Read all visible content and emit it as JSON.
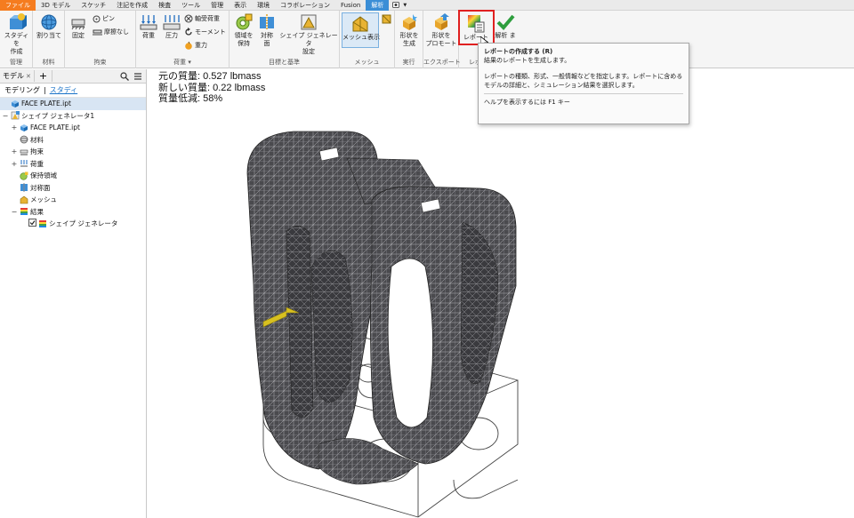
{
  "menu": {
    "items": [
      "ファイル",
      "3D モデル",
      "スケッチ",
      "注記を作成",
      "検査",
      "ツール",
      "管理",
      "表示",
      "環境",
      "コラボレーション",
      "Fusion",
      "解析"
    ],
    "active": "解析"
  },
  "ribbon": {
    "manage": {
      "label": "管理",
      "study_btn": "スタディを\n作成"
    },
    "material": {
      "label": "材料",
      "assign_btn": "割り当て"
    },
    "constraints": {
      "label": "拘束",
      "fixed_btn": "固定",
      "pin_btn": "ピン",
      "frictionless_btn": "摩擦なし"
    },
    "loads": {
      "label": "荷重 ▾",
      "load_btn": "荷重",
      "pressure_btn": "圧力",
      "bearing_btn": "軸受荷重",
      "moment_btn": "モーメント",
      "gravity_btn": "重力"
    },
    "goals": {
      "label": "目標と基準",
      "preserve_btn": "領域を\n保持",
      "symmetry_btn": "対称\n面",
      "shape_gen_btn": "シェイプ ジェネレータ\n設定"
    },
    "mesh": {
      "label": "メッシュ",
      "mesh_view_btn": "メッシュ表示"
    },
    "run": {
      "label": "実行",
      "generate_btn": "形状を\n生成"
    },
    "export": {
      "label": "エクスポート",
      "promote_btn": "形状を\nプロモート"
    },
    "report": {
      "label": "レポ",
      "report_btn": "レポート"
    },
    "finish": {
      "label": "",
      "finish_btn": "解析 ま"
    }
  },
  "panel": {
    "tab_model": "モデル",
    "tab_plus": "+",
    "sub_modeling": "モデリング",
    "sub_sep": "|",
    "sub_study": "スタディ",
    "tree": [
      {
        "label": "FACE PLATE.ipt",
        "level": 0,
        "toggle": "",
        "icon": "part"
      },
      {
        "label": "シェイプ ジェネレータ1",
        "level": 0,
        "toggle": "−",
        "icon": "shapegen"
      },
      {
        "label": "FACE PLATE.ipt",
        "level": 1,
        "toggle": "+",
        "icon": "part"
      },
      {
        "label": "材料",
        "level": 1,
        "toggle": "",
        "icon": "material"
      },
      {
        "label": "拘束",
        "level": 1,
        "toggle": "+",
        "icon": "constraint"
      },
      {
        "label": "荷重",
        "level": 1,
        "toggle": "+",
        "icon": "load"
      },
      {
        "label": "保持領域",
        "level": 1,
        "toggle": "",
        "icon": "preserve"
      },
      {
        "label": "対称面",
        "level": 1,
        "toggle": "",
        "icon": "symmetry"
      },
      {
        "label": "メッシュ",
        "level": 1,
        "toggle": "",
        "icon": "mesh"
      },
      {
        "label": "結果",
        "level": 1,
        "toggle": "−",
        "icon": "result"
      },
      {
        "label": "シェイプ ジェネレータ",
        "level": 2,
        "toggle": "",
        "icon": "result",
        "checkbox": true
      }
    ]
  },
  "stats": {
    "original_mass": "元の質量: 0.527 lbmass",
    "new_mass": "新しい質量: 0.22 lbmass",
    "reduction": "質量低減: 58%"
  },
  "tooltip": {
    "title": "レポートの作成する (R)",
    "subtitle": "結果のレポートを生成します。",
    "description": "レポートの種類、形式、一般情報などを指定します。レポートに含めるモデルの詳細と、シミュレーション結果を選択します。",
    "help": "ヘルプを表示するには F1 キー"
  },
  "colors": {
    "file_tab": "#f57c1f",
    "active_tab": "#3b8ed6",
    "highlight": "#e02020",
    "mesh": "#4a4a4e"
  }
}
